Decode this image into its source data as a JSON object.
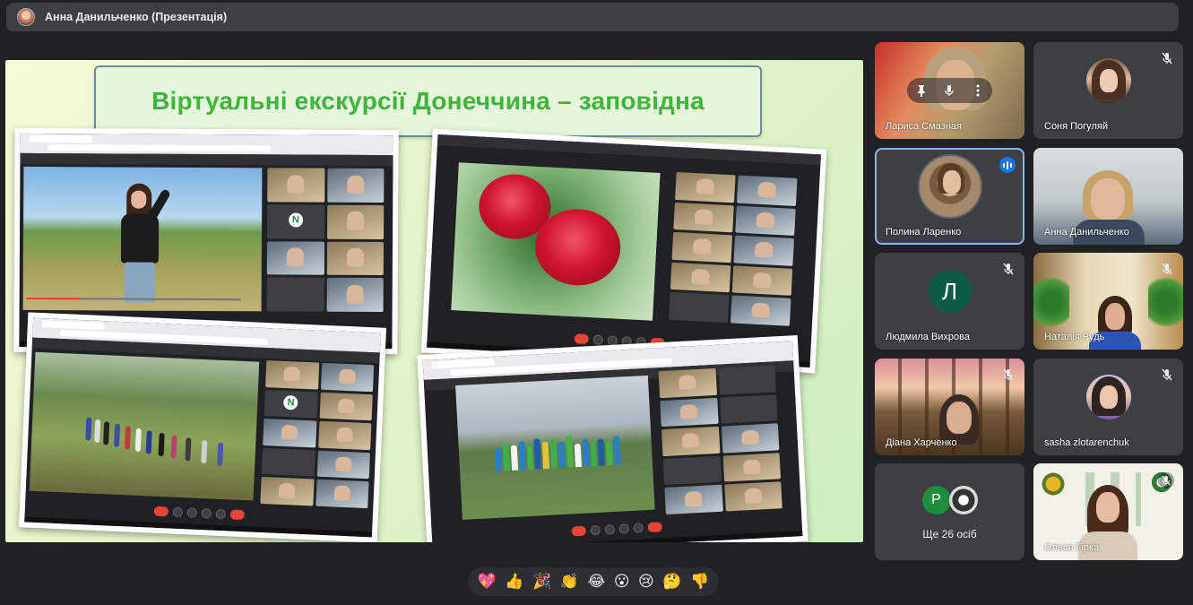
{
  "presenter": {
    "name": "Анна Данильченко (Презентація)"
  },
  "slide": {
    "title": "Віртуальні екскурсії Донеччина – заповідна"
  },
  "participants": [
    {
      "name": "Лариса Смазная",
      "muted": false
    },
    {
      "name": "Соня Погуляй",
      "muted": true
    },
    {
      "name": "Полина Ларенко",
      "speaking": true
    },
    {
      "name": "Анна Данильченко",
      "muted": false
    },
    {
      "name": "Людмила Вихрова",
      "muted": true,
      "initial": "Л",
      "avatar_color": "#0b5b45"
    },
    {
      "name": "Наталія Рудь",
      "muted": true
    },
    {
      "name": "Діана Харченко",
      "muted": true
    },
    {
      "name": "sasha zlotarenchuk",
      "muted": true
    },
    {
      "name": "Олеся Гірка",
      "muted": true
    }
  ],
  "more": {
    "label": "Ще 26 осіб",
    "initial": "Р",
    "avatar_color": "#1e8e3e"
  },
  "reactions": [
    "💖",
    "👍",
    "🎉",
    "👏",
    "😂",
    "😮",
    "😢",
    "🤔",
    "👎"
  ],
  "colors": {
    "background": "#202124",
    "tile": "#3c4043",
    "title_green": "#3fb53a",
    "speaking_outline": "#8ab4f8"
  }
}
